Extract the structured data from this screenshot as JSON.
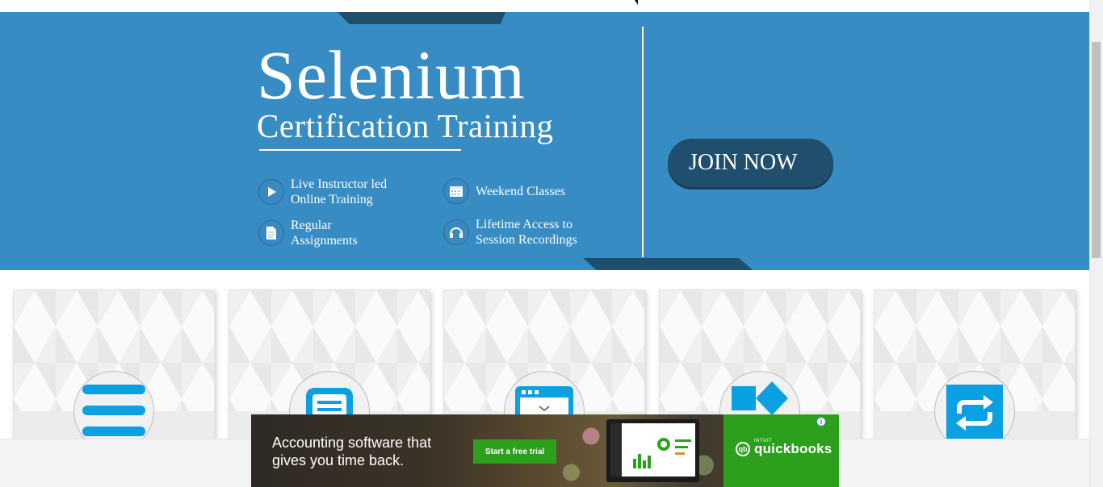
{
  "banner": {
    "title": "Selenium",
    "subtitle": "Certification Training",
    "features": [
      {
        "icon": "play-icon",
        "label_line1": "Live Instructor led",
        "label_line2": "Online Training"
      },
      {
        "icon": "calendar-icon",
        "label_line1": "Weekend Classes",
        "label_line2": ""
      },
      {
        "icon": "document-icon",
        "label_line1": "Regular",
        "label_line2": "Assignments"
      },
      {
        "icon": "headphones-icon",
        "label_line1": "Lifetime Access to",
        "label_line2": "Session Recordings"
      }
    ],
    "join_label": "JOIN NOW",
    "colors": {
      "background": "#388cc4",
      "dark": "#1f4f6c"
    }
  },
  "cards": [
    {
      "icon": "menu-lines-icon"
    },
    {
      "icon": "text-document-icon"
    },
    {
      "icon": "browser-window-icon"
    },
    {
      "icon": "shapes-icon"
    },
    {
      "icon": "repeat-arrows-icon"
    }
  ],
  "ad": {
    "headline_line1": "Accounting software that",
    "headline_line2": "gives you time back.",
    "cta": "Start a free trial",
    "brand_prefix": "INTUIT",
    "brand": "quickbooks",
    "brand_mark": "qb",
    "info": "i",
    "colors": {
      "brand_green": "#2ca01c"
    }
  }
}
